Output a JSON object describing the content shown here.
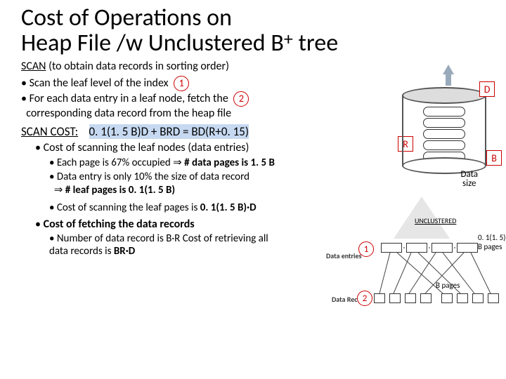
{
  "title_line1": "Cost of Operations on",
  "title_line2a": "Heap File /w Unclustered B",
  "title_sup": "+",
  "title_line2b": "tree",
  "scan_heading": "SCAN",
  "scan_paren": " (to obtain data records in sorting order)",
  "bullet1": "Scan the leaf level of the index",
  "bullet2a": "For each data entry in a leaf node, fetch the",
  "bullet2b": "corresponding data record from the heap file",
  "badge1": "1",
  "badge2": "2",
  "scan_cost_label": "SCAN COST:",
  "scan_cost_formula": "0. 1(1. 5 B)D + BRD =  BD(R+0. 15)",
  "cost_line1": "Cost of scanning the leaf nodes (data entries)",
  "sub1a": "Each page is 67% occupied ",
  "sub1a_imp": "⇒",
  "sub1a_b": " # data pages is 1. 5 B",
  "sub1b": "Data entry is only 10% the size of data record",
  "sub1c_imp": "⇒",
  "sub1c": "  # leaf pages is 0. 1(1. 5 B)",
  "sub1d_a": "Cost of scanning the leaf pages is ",
  "sub1d_b": "0. 1(1. 5 B)·D",
  "fetch_line": "Cost of fetching the data records",
  "subf_a": "Number of data record is B·R  Cost of retrieving all data records is ",
  "subf_b": "BR·D",
  "diag": {
    "D": "D",
    "R": "R",
    "B": "B",
    "datasize": "Data\nsize",
    "unclustered": "UNCLUSTERED",
    "data_entries": "Data entries",
    "data_records": "Data Records",
    "leaf_label": "0. 1(1. 5) B pages",
    "rec_label": "B pages",
    "one": "1",
    "two": "2"
  }
}
